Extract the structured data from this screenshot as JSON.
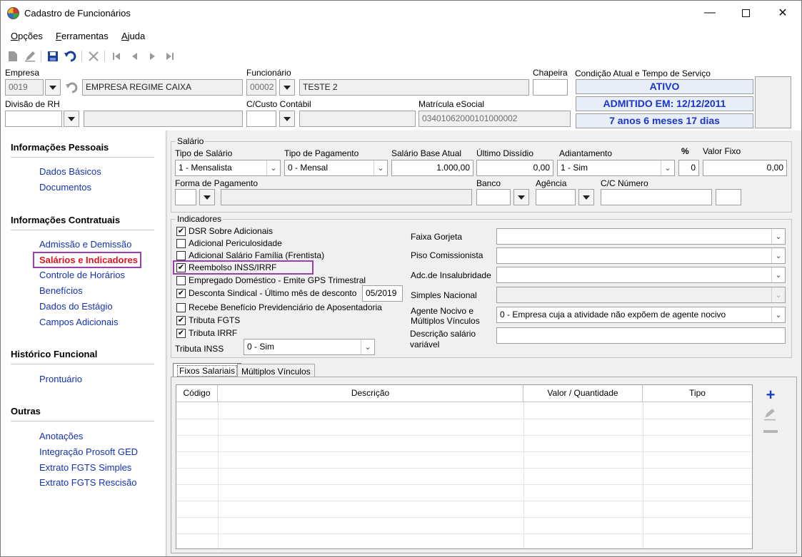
{
  "window": {
    "title": "Cadastro de Funcionários",
    "minimize_icon": "minimize-icon",
    "maximize_icon": "maximize-icon",
    "close_icon": "close-icon"
  },
  "menu": [
    {
      "prefix": "",
      "ul": "O",
      "rest": "pções"
    },
    {
      "prefix": "",
      "ul": "F",
      "rest": "erramentas"
    },
    {
      "prefix": "",
      "ul": "A",
      "rest": "juda"
    }
  ],
  "toolbar": {
    "icons": [
      "new-icon",
      "edit-icon",
      "save-icon",
      "undo-icon",
      "delete-icon",
      "first-icon",
      "prev-icon",
      "next-icon",
      "last-icon"
    ]
  },
  "header": {
    "empresa_label": "Empresa",
    "empresa_code": "0019",
    "empresa_name": "EMPRESA REGIME CAIXA",
    "funcionario_label": "Funcionário",
    "funcionario_code": "00002",
    "funcionario_name": "TESTE 2",
    "chapeira_label": "Chapeira",
    "chapeira_value": "",
    "condicao_label": "Condição Atual e Tempo de Serviço",
    "status": "ATIVO",
    "admitido": "ADMITIDO EM: 12/12/2011",
    "tempo": "7 anos 6 meses 17 dias",
    "divisao_label": "Divisão de RH",
    "custo_label": "C/Custo Contábil",
    "matricula_label": "Matrícula eSocial",
    "matricula_value": "03401062000101000002"
  },
  "sidebar": {
    "sections": [
      {
        "title": "Informações Pessoais",
        "items": [
          "Dados Básicos",
          "Documentos"
        ]
      },
      {
        "title": "Informações Contratuais",
        "items": [
          "Admissão e Demissão",
          "Salários e Indicadores",
          "Controle de Horários",
          "Benefícios",
          "Dados do Estágio",
          "Campos Adicionais"
        ]
      },
      {
        "title": "Histórico Funcional",
        "items": [
          "Prontuário"
        ]
      },
      {
        "title": "Outras",
        "items": [
          "Anotações",
          "Integração Prosoft GED",
          "Extrato FGTS Simples",
          "Extrato FGTS Rescisão"
        ]
      }
    ],
    "active": "Salários e Indicadores"
  },
  "salario": {
    "group_title": "Salário",
    "tipo_salario_label": "Tipo de Salário",
    "tipo_salario_value": "1 - Mensalista",
    "tipo_pagamento_label": "Tipo de Pagamento",
    "tipo_pagamento_value": "0 - Mensal",
    "salario_base_label": "Salário Base Atual",
    "salario_base_value": "1.000,00",
    "ultimo_dissidio_label": "Último Dissídio",
    "ultimo_dissidio_value": "0,00",
    "adiantamento_label": "Adiantamento",
    "adiantamento_value": "1 - Sim",
    "percent_label": "%",
    "percent_value": "0",
    "valor_fixo_label": "Valor Fixo",
    "valor_fixo_value": "0,00",
    "forma_pagamento_label": "Forma de Pagamento",
    "banco_label": "Banco",
    "agencia_label": "Agência",
    "cc_label": "C/C Número"
  },
  "indicadores": {
    "group_title": "Indicadores",
    "checks": [
      {
        "label": "DSR Sobre Adicionais",
        "checked": true
      },
      {
        "label": "Adicional Periculosidade",
        "checked": false
      },
      {
        "label": "Adicional Salário Família (Frentista)",
        "checked": false
      },
      {
        "label": "Reembolso INSS/IRRF",
        "checked": true
      },
      {
        "label": "Empregado Doméstico - Emite GPS Trimestral",
        "checked": false
      },
      {
        "label": "Desconta Sindical - Último mês de desconto",
        "checked": true
      },
      {
        "label": "Recebe Benefício Previdenciário de Aposentadoria",
        "checked": false
      },
      {
        "label": "Tributa FGTS",
        "checked": true
      },
      {
        "label": "Tributa IRRF",
        "checked": true
      }
    ],
    "sindical_month": "05/2019",
    "tributa_inss_label": "Tributa INSS",
    "tributa_inss_value": "0 - Sim",
    "faixa_gorjeta_label": "Faixa Gorjeta",
    "piso_label": "Piso Comissionista",
    "insalubridade_label": "Adc.de Insalubridade",
    "simples_label": "Simples Nacional",
    "agente_label_1": "Agente Nocivo e",
    "agente_label_2": "Múltiplos Vínculos",
    "agente_value": "0 - Empresa cuja a atividade não expõem de agente nocivo",
    "descricao_label_1": "Descrição salário",
    "descricao_label_2": "variável"
  },
  "tabs": [
    "Fixos Salariais",
    "Múltiplos Vínculos"
  ],
  "grid": {
    "columns": [
      "Código",
      "Descrição",
      "Valor / Quantidade",
      "Tipo"
    ]
  },
  "grid_actions": [
    "add-icon",
    "edit-icon",
    "remove-icon"
  ],
  "check_mark": "✔"
}
